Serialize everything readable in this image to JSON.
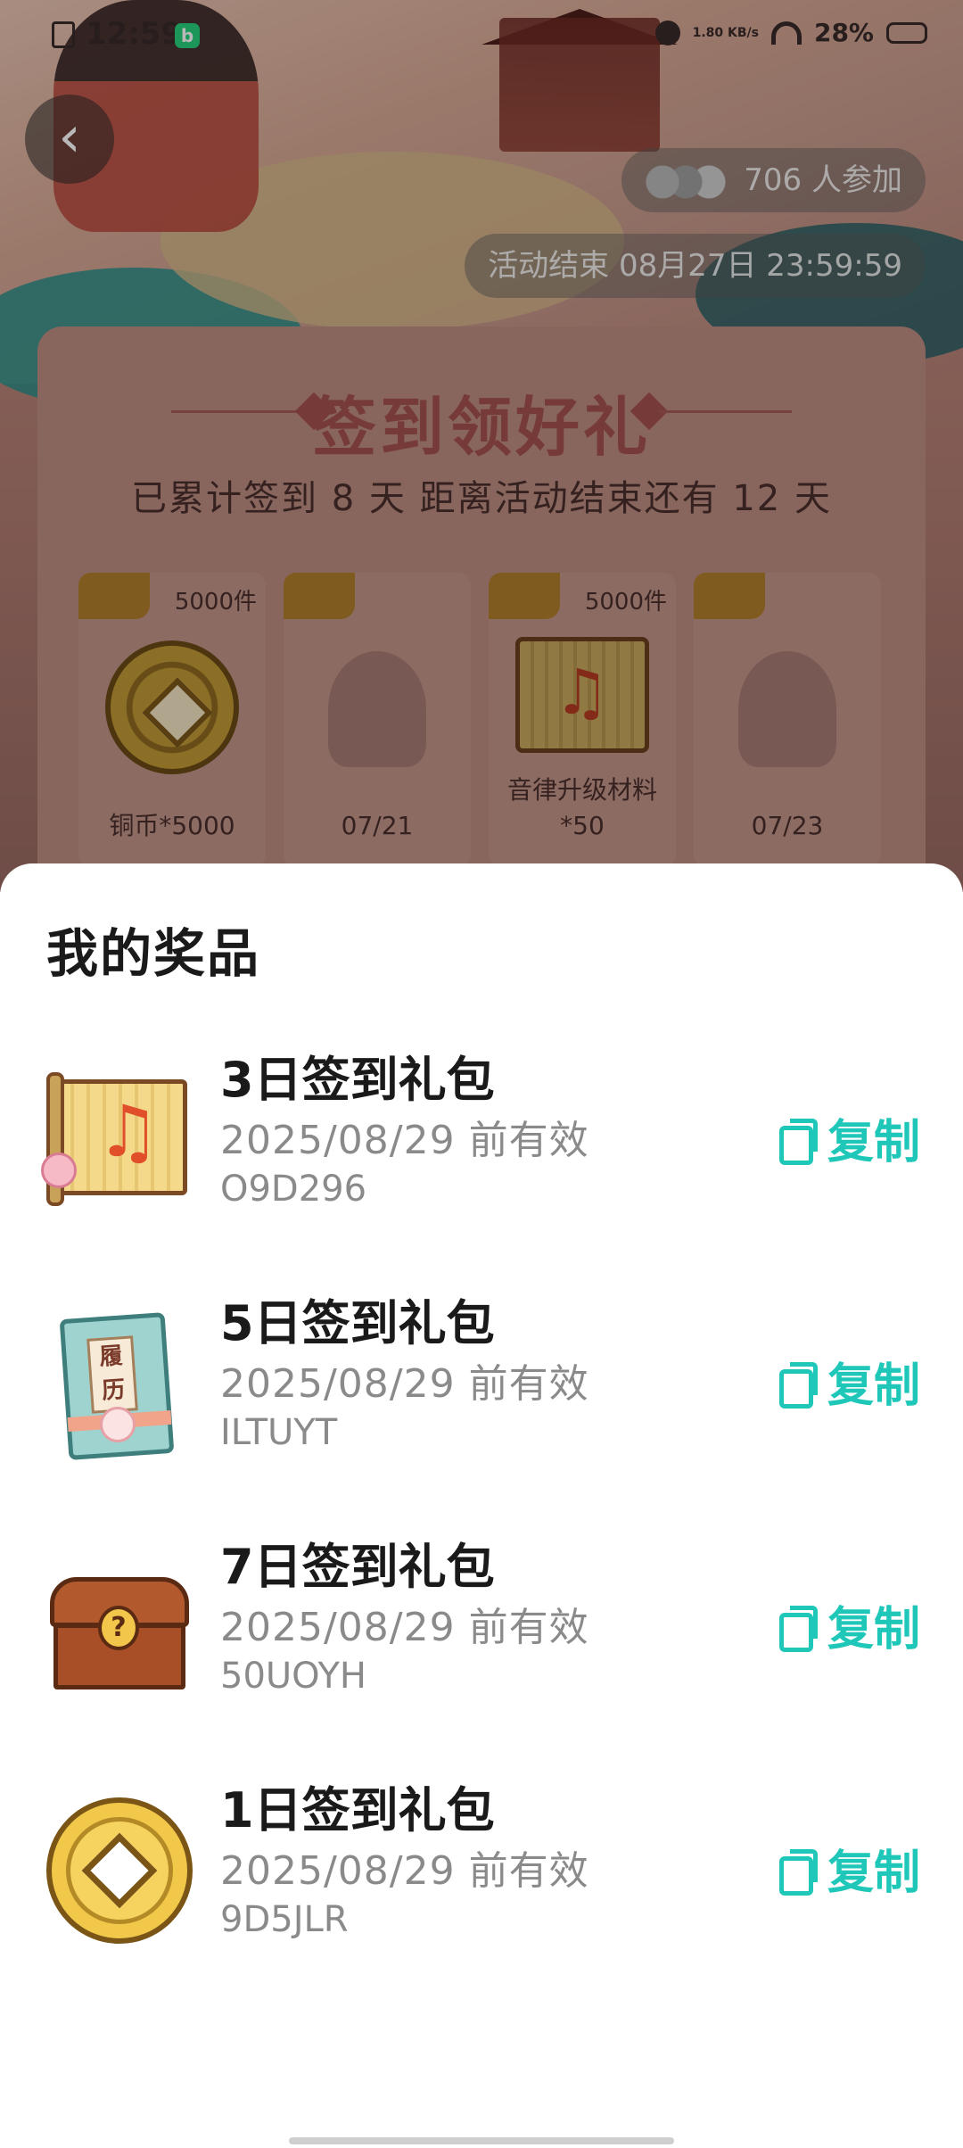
{
  "status_bar": {
    "time": "12:59",
    "app_badge": "b",
    "net_speed": "1.80\nKB/s",
    "battery": "28%"
  },
  "activity": {
    "participants": "706 人参加",
    "end_time": "活动结束 08月27日 23:59:59",
    "title": "签到领好礼",
    "subtitle": "已累计签到 8 天 距离活动结束还有 12 天",
    "days": [
      {
        "qty": "5000件",
        "label": "铜币*5000",
        "icon": "coin-icon"
      },
      {
        "qty": "",
        "label": "07/21",
        "icon": "locked-avatar-icon"
      },
      {
        "qty": "5000件",
        "label": "音律升级材料*50",
        "icon": "music-scroll-icon"
      },
      {
        "qty": "",
        "label": "07/23",
        "icon": "locked-avatar-icon"
      }
    ]
  },
  "sheet": {
    "title": "我的奖品",
    "copy_label": "复制",
    "prizes": [
      {
        "name": "3日签到礼包",
        "valid": "2025/08/29 前有效",
        "code": "O9D296",
        "icon": "music-scroll-icon"
      },
      {
        "name": "5日签到礼包",
        "valid": "2025/08/29 前有效",
        "code": "ILTUYT",
        "icon": "resume-book-icon"
      },
      {
        "name": "7日签到礼包",
        "valid": "2025/08/29 前有效",
        "code": "50UOYH",
        "icon": "mystery-chest-icon"
      },
      {
        "name": "1日签到礼包",
        "valid": "2025/08/29 前有效",
        "code": "9D5JLR",
        "icon": "copper-coin-icon"
      }
    ],
    "book_label": "履历",
    "chest_symbol": "?"
  },
  "colors": {
    "accent": "#1fc7b9",
    "title_red": "#a4534e"
  }
}
